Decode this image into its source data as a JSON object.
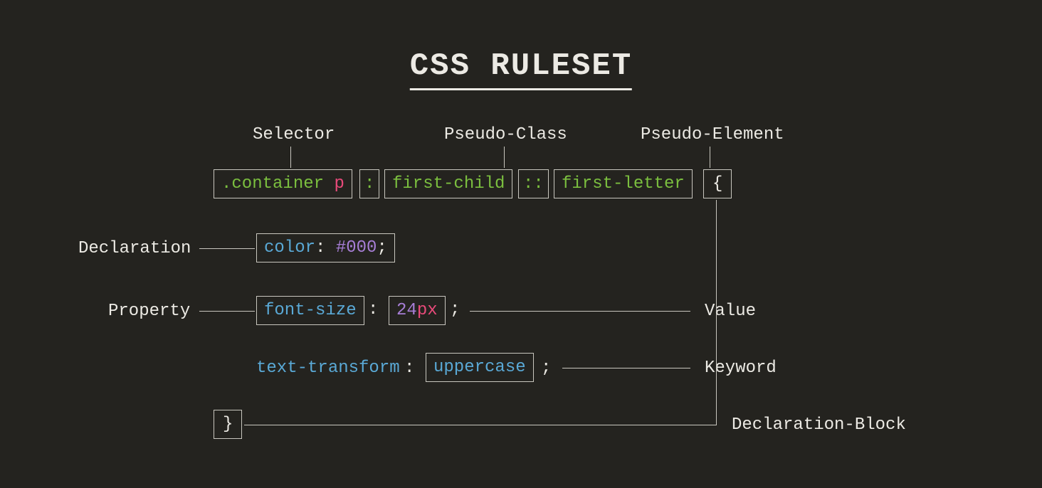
{
  "title": "CSS RULESET",
  "labels": {
    "selector": "Selector",
    "pseudo_class": "Pseudo-Class",
    "pseudo_element": "Pseudo-Element",
    "declaration": "Declaration",
    "property": "Property",
    "value": "Value",
    "keyword": "Keyword",
    "declaration_block": "Declaration-Block"
  },
  "code": {
    "selector_class": ".container ",
    "selector_elem": "p",
    "colon1": ":",
    "pseudo_class": "first-child",
    "colon2": "::",
    "pseudo_element": "first-letter",
    "brace_open": "{",
    "decl1_prop": "color",
    "decl1_colon": ":",
    "decl1_val": "#000",
    "decl1_semi": ";",
    "decl2_prop": "font-size",
    "decl2_colon": ":",
    "decl2_num": "24",
    "decl2_unit": "px",
    "decl2_semi": ";",
    "decl3_prop": "text-transform",
    "decl3_colon": ":",
    "decl3_val": "uppercase",
    "decl3_semi": ";",
    "brace_close": "}"
  }
}
